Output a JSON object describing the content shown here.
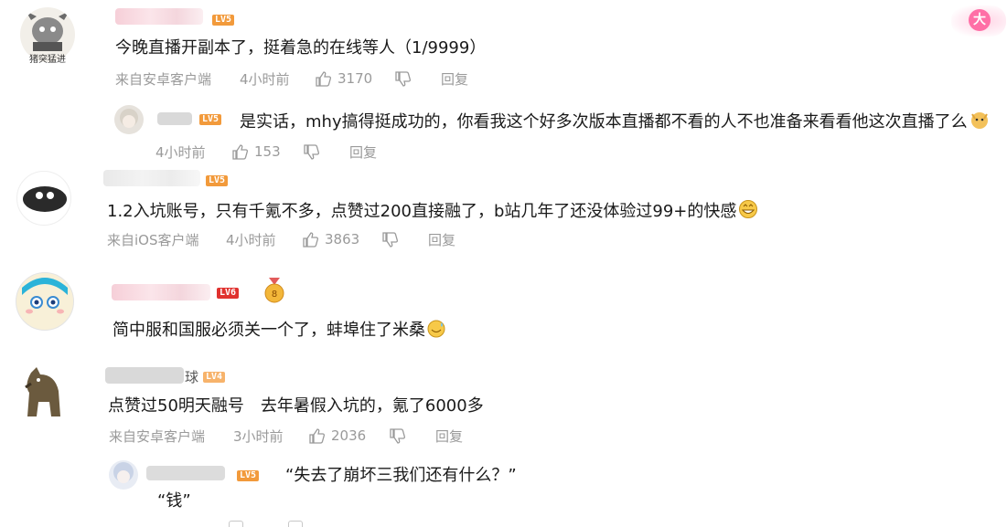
{
  "colors": {
    "lv5": "#f29a3b",
    "lv6": "#e0322f",
    "lv4": "#f7b36b",
    "meta": "#9a9a9a"
  },
  "top_badge": {
    "label": "大",
    "icon": "vip-badge-icon"
  },
  "comments": [
    {
      "name_tail": "",
      "level": "LV5",
      "text": "今晚直播开副本了，挺着急的在线等人（1/9999）",
      "avatar_caption": "猪突猛进",
      "source": "来自安卓客户端",
      "time": "4小时前",
      "likes": "3170",
      "reply": "回复",
      "sub": {
        "level": "LV5",
        "text": "是实话，mhy搞得挺成功的，你看我这个好多次版本直播都不看的人不也准备来看看他这次直播了么",
        "time": "4小时前",
        "likes": "153",
        "reply": "回复"
      }
    },
    {
      "level": "LV5",
      "text": "1.2入坑账号，只有千氪不多，点赞过200直接融了，b站几年了还没体验过99+的快感",
      "source": "来自iOS客户端",
      "time": "4小时前",
      "likes": "3863",
      "reply": "回复"
    },
    {
      "level": "LV6",
      "text": "简中服和国服必须关一个了，蚌埠住了米桑"
    },
    {
      "name_tail": "球",
      "level": "LV4",
      "text": "点赞过50明天融号　去年暑假入坑的，氪了6000多",
      "source": "来自安卓客户端",
      "time": "3小时前",
      "likes": "2036",
      "reply": "回复",
      "sub": {
        "level": "LV5",
        "text": "“失去了崩坏三我们还有什么？”",
        "text2": "“钱”"
      }
    }
  ]
}
